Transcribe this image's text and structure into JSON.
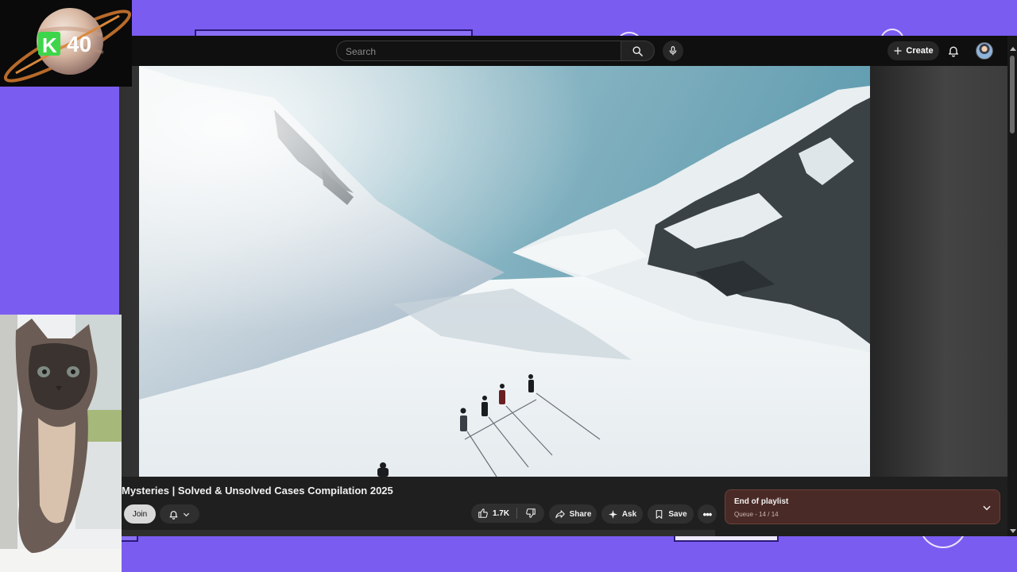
{
  "topbar": {
    "search_placeholder": "Search",
    "create_label": "Create"
  },
  "overlay": {
    "logo_letter": "K",
    "logo_number": "40"
  },
  "video": {
    "title": "Mysteries | Solved & Unsolved Cases Compilation 2025"
  },
  "actions": {
    "join_label": "Join",
    "like_count": "1.7K",
    "share_label": "Share",
    "ask_label": "Ask",
    "save_label": "Save"
  },
  "playlist": {
    "title": "End of playlist",
    "queue": "Queue - 14 / 14"
  },
  "colors": {
    "page_background": "#7b5cf0",
    "playlist_box": "#4a2a26"
  }
}
